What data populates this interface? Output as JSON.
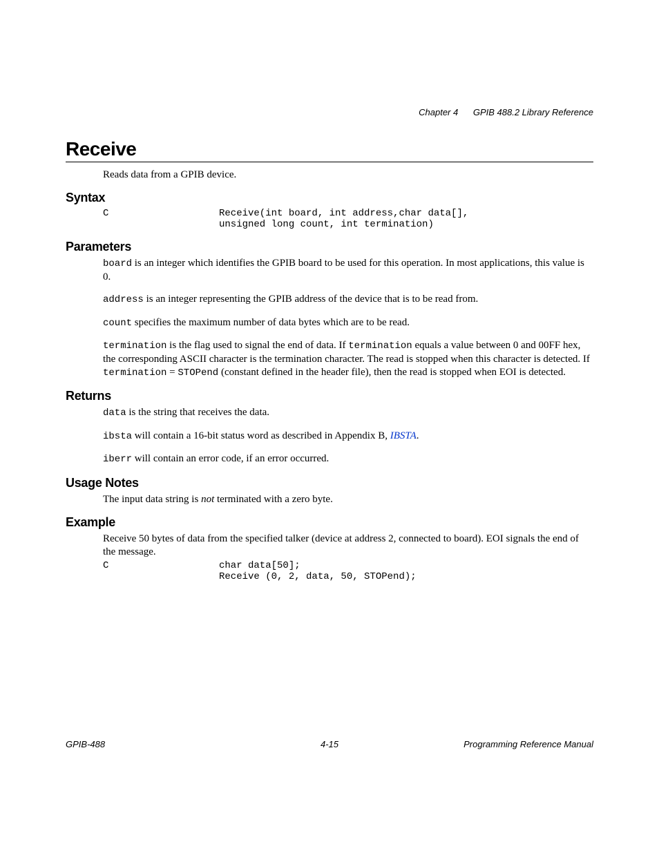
{
  "header": {
    "chapter": "Chapter 4",
    "section": "GPIB 488.2 Library Reference"
  },
  "title": "Receive",
  "intro": "Reads data from a GPIB device.",
  "syntax": {
    "heading": "Syntax",
    "lang": "C",
    "code": "Receive(int board, int address,char data[],\nunsigned long count, int termination)"
  },
  "parameters": {
    "heading": "Parameters",
    "p1_code": "board",
    "p1_text": " is an integer which identifies the GPIB board to be used for this operation. In most applications, this value is 0.",
    "p2_code": "address",
    "p2_text": " is an integer representing the GPIB address of the device that is to be read from.",
    "p3_code": "count",
    "p3_text": " specifies the maximum number of data bytes which are to be read.",
    "p4_code1": "termination",
    "p4_text1": " is the flag used to signal the end of data. If ",
    "p4_code2": "termination",
    "p4_text2": " equals a value between 0 and 00FF hex, the corresponding ASCII character is the termination character. The read is stopped when this character is detected. If ",
    "p4_code3": "termination",
    "p4_text3": " = ",
    "p4_code4": "STOPend",
    "p4_text4": " (constant defined in the header file), then the read is stopped when EOI is detected."
  },
  "returns": {
    "heading": "Returns",
    "p1_code": "data",
    "p1_text": " is the string that receives the data.",
    "p2_code": "ibsta",
    "p2_text1": " will contain a 16-bit status word as described in Appendix B, ",
    "p2_link": "IBSTA",
    "p2_text2": ".",
    "p3_code": "iberr",
    "p3_text": " will contain an error code, if an error occurred."
  },
  "usage": {
    "heading": "Usage Notes",
    "text1": "The input data string is ",
    "italic": "not",
    "text2": " terminated with a zero byte."
  },
  "example": {
    "heading": "Example",
    "desc": "Receive 50 bytes of data from the specified talker (device at address 2, connected to board). EOI signals the end of the message.",
    "lang": "C",
    "code": "char data[50];\nReceive (0, 2, data, 50, STOPend);"
  },
  "footer": {
    "left": "GPIB-488",
    "center": "4-15",
    "right": "Programming Reference Manual"
  }
}
